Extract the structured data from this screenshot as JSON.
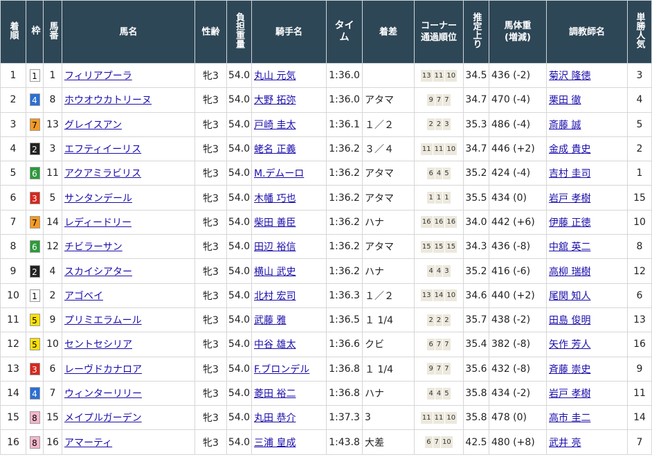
{
  "headers": {
    "rank": "着順",
    "waku": "枠",
    "num": "馬番",
    "horse": "馬名",
    "sexage": "性齢",
    "weight": "負担重量",
    "jockey": "騎手名",
    "time": "タイム",
    "margin": "着差",
    "corner": "コーナー通過順位",
    "last3f": "推定上り",
    "bodyweight": "馬体重(増減)",
    "trainer": "調教師名",
    "pop": "単勝人気"
  },
  "waku_colors": {
    "1": {
      "bg": "#ffffff",
      "fg": "#000000"
    },
    "2": {
      "bg": "#222222",
      "fg": "#ffffff"
    },
    "3": {
      "bg": "#d9261c",
      "fg": "#ffffff"
    },
    "4": {
      "bg": "#2a6fd6",
      "fg": "#ffffff"
    },
    "5": {
      "bg": "#ffe000",
      "fg": "#000000"
    },
    "6": {
      "bg": "#2a9b3a",
      "fg": "#ffffff"
    },
    "7": {
      "bg": "#f59a23",
      "fg": "#000000"
    },
    "8": {
      "bg": "#f7b6cc",
      "fg": "#000000"
    }
  },
  "rows": [
    {
      "rank": "1",
      "waku": "1",
      "num": "1",
      "horse": "フィリアプーラ",
      "sexage": "牝3",
      "weight": "54.0",
      "jockey": "丸山 元気",
      "time": "1:36.0",
      "margin": "",
      "corner": [
        "13",
        "11",
        "10"
      ],
      "last3f": "34.5",
      "bodyweight": "436 (-2)",
      "trainer": "菊沢 隆徳",
      "pop": "3"
    },
    {
      "rank": "2",
      "waku": "4",
      "num": "8",
      "horse": "ホウオウカトリーヌ",
      "sexage": "牝3",
      "weight": "54.0",
      "jockey": "大野 拓弥",
      "time": "1:36.0",
      "margin": "アタマ",
      "corner": [
        "9",
        "7",
        "7"
      ],
      "last3f": "34.7",
      "bodyweight": "470 (-4)",
      "trainer": "栗田 徹",
      "pop": "4"
    },
    {
      "rank": "3",
      "waku": "7",
      "num": "13",
      "horse": "グレイスアン",
      "sexage": "牝3",
      "weight": "54.0",
      "jockey": "戸崎 圭太",
      "time": "1:36.1",
      "margin": "１／２",
      "corner": [
        "2",
        "2",
        "3"
      ],
      "last3f": "35.3",
      "bodyweight": "486 (-4)",
      "trainer": "斎藤 誠",
      "pop": "5"
    },
    {
      "rank": "4",
      "waku": "2",
      "num": "3",
      "horse": "エフティイーリス",
      "sexage": "牝3",
      "weight": "54.0",
      "jockey": "蛯名 正義",
      "time": "1:36.2",
      "margin": "３／４",
      "corner": [
        "11",
        "11",
        "10"
      ],
      "last3f": "34.7",
      "bodyweight": "446 (+2)",
      "trainer": "金成 貴史",
      "pop": "2"
    },
    {
      "rank": "5",
      "waku": "6",
      "num": "11",
      "horse": "アクアミラビリス",
      "sexage": "牝3",
      "weight": "54.0",
      "jockey": "M.デムーロ",
      "time": "1:36.2",
      "margin": "アタマ",
      "corner": [
        "6",
        "4",
        "5"
      ],
      "last3f": "35.2",
      "bodyweight": "424 (-4)",
      "trainer": "吉村 圭司",
      "pop": "1"
    },
    {
      "rank": "6",
      "waku": "3",
      "num": "5",
      "horse": "サンタンデール",
      "sexage": "牝3",
      "weight": "54.0",
      "jockey": "木幡 巧也",
      "time": "1:36.2",
      "margin": "アタマ",
      "corner": [
        "1",
        "1",
        "1"
      ],
      "last3f": "35.5",
      "bodyweight": "434 (0)",
      "trainer": "岩戸 孝樹",
      "pop": "15"
    },
    {
      "rank": "7",
      "waku": "7",
      "num": "14",
      "horse": "レディードリー",
      "sexage": "牝3",
      "weight": "54.0",
      "jockey": "柴田 善臣",
      "time": "1:36.2",
      "margin": "ハナ",
      "corner": [
        "16",
        "16",
        "16"
      ],
      "last3f": "34.0",
      "bodyweight": "442 (+6)",
      "trainer": "伊藤 正徳",
      "pop": "10"
    },
    {
      "rank": "8",
      "waku": "6",
      "num": "12",
      "horse": "チビラーサン",
      "sexage": "牝3",
      "weight": "54.0",
      "jockey": "田辺 裕信",
      "time": "1:36.2",
      "margin": "アタマ",
      "corner": [
        "15",
        "15",
        "15"
      ],
      "last3f": "34.3",
      "bodyweight": "436 (-8)",
      "trainer": "中舘 英二",
      "pop": "8"
    },
    {
      "rank": "9",
      "waku": "2",
      "num": "4",
      "horse": "スカイシアター",
      "sexage": "牝3",
      "weight": "54.0",
      "jockey": "横山 武史",
      "time": "1:36.2",
      "margin": "ハナ",
      "corner": [
        "4",
        "4",
        "3"
      ],
      "last3f": "35.2",
      "bodyweight": "416 (-6)",
      "trainer": "高柳 瑞樹",
      "pop": "12"
    },
    {
      "rank": "10",
      "waku": "1",
      "num": "2",
      "horse": "アゴベイ",
      "sexage": "牝3",
      "weight": "54.0",
      "jockey": "北村 宏司",
      "time": "1:36.3",
      "margin": "１／２",
      "corner": [
        "13",
        "14",
        "10"
      ],
      "last3f": "34.6",
      "bodyweight": "440 (+2)",
      "trainer": "尾関 知人",
      "pop": "6"
    },
    {
      "rank": "11",
      "waku": "5",
      "num": "9",
      "horse": "プリミエラムール",
      "sexage": "牝3",
      "weight": "54.0",
      "jockey": "武藤 雅",
      "time": "1:36.5",
      "margin": "１ 1/4",
      "corner": [
        "2",
        "2",
        "2"
      ],
      "last3f": "35.7",
      "bodyweight": "438 (-2)",
      "trainer": "田島 俊明",
      "pop": "13"
    },
    {
      "rank": "12",
      "waku": "5",
      "num": "10",
      "horse": "セントセシリア",
      "sexage": "牝3",
      "weight": "54.0",
      "jockey": "中谷 雄太",
      "time": "1:36.6",
      "margin": "クビ",
      "corner": [
        "6",
        "7",
        "7"
      ],
      "last3f": "35.4",
      "bodyweight": "382 (-8)",
      "trainer": "矢作 芳人",
      "pop": "16"
    },
    {
      "rank": "13",
      "waku": "3",
      "num": "6",
      "horse": "レーヴドカナロア",
      "sexage": "牝3",
      "weight": "54.0",
      "jockey": "F.ブロンデル",
      "time": "1:36.8",
      "margin": "１ 1/4",
      "corner": [
        "9",
        "7",
        "7"
      ],
      "last3f": "35.6",
      "bodyweight": "432 (-8)",
      "trainer": "斉藤 崇史",
      "pop": "9"
    },
    {
      "rank": "14",
      "waku": "4",
      "num": "7",
      "horse": "ウィンターリリー",
      "sexage": "牝3",
      "weight": "54.0",
      "jockey": "菱田 裕二",
      "time": "1:36.8",
      "margin": "ハナ",
      "corner": [
        "4",
        "4",
        "5"
      ],
      "last3f": "35.8",
      "bodyweight": "434 (-2)",
      "trainer": "岩戸 孝樹",
      "pop": "11"
    },
    {
      "rank": "15",
      "waku": "8",
      "num": "15",
      "horse": "メイプルガーデン",
      "sexage": "牝3",
      "weight": "54.0",
      "jockey": "丸田 恭介",
      "time": "1:37.3",
      "margin": "3",
      "corner": [
        "11",
        "11",
        "10"
      ],
      "last3f": "35.8",
      "bodyweight": "478 (0)",
      "trainer": "高市 圭二",
      "pop": "14"
    },
    {
      "rank": "16",
      "waku": "8",
      "num": "16",
      "horse": "アマーティ",
      "sexage": "牝3",
      "weight": "54.0",
      "jockey": "三浦 皇成",
      "time": "1:43.8",
      "margin": "大差",
      "corner": [
        "6",
        "7",
        "10"
      ],
      "last3f": "42.5",
      "bodyweight": "480 (+8)",
      "trainer": "武井 亮",
      "pop": "7"
    }
  ]
}
